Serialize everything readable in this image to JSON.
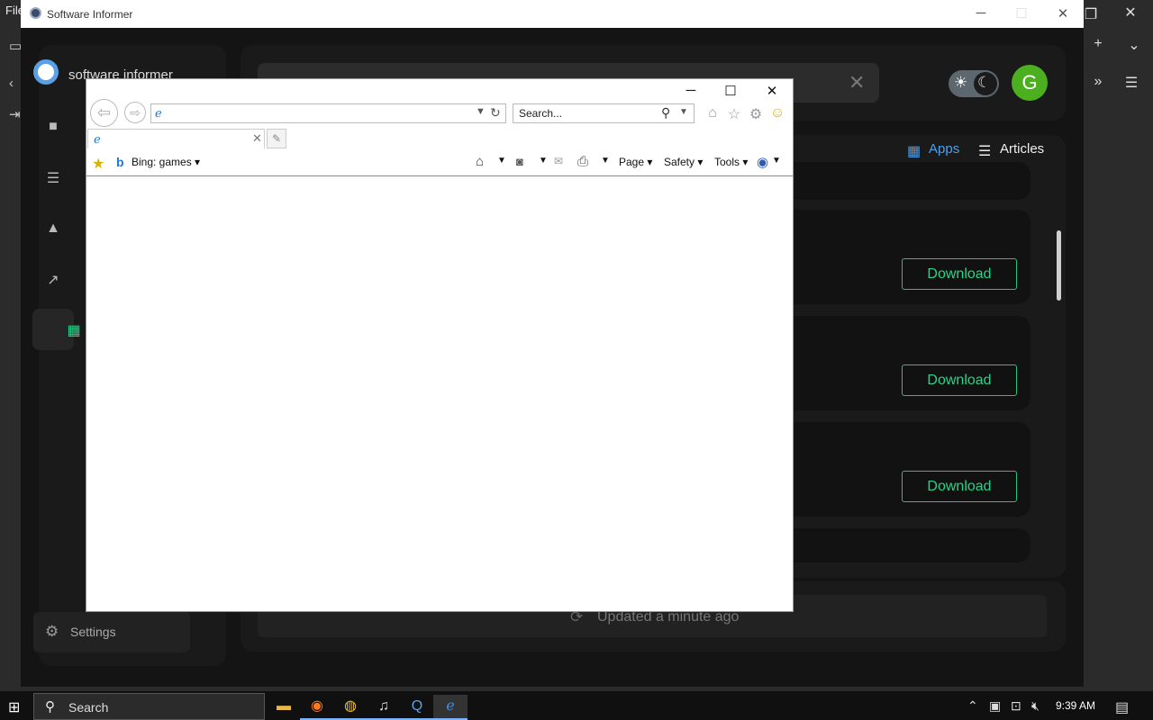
{
  "background_app": {
    "menu_file": "File"
  },
  "software_informer": {
    "title": "Software Informer",
    "logo_text": "software informer",
    "avatar_letter": "G",
    "tabs": [
      {
        "label": "Apps",
        "active": true
      },
      {
        "label": "Articles",
        "active": false
      }
    ],
    "download_buttons": [
      "Download",
      "Download",
      "Download"
    ],
    "settings_label": "Settings",
    "status_text": "Updated a minute ago"
  },
  "ie": {
    "search_placeholder": "Search...",
    "favorites_link": "Bing: games",
    "commands": [
      "Page",
      "Safety",
      "Tools"
    ]
  },
  "taskbar": {
    "search_label": "Search",
    "clock": "9:39 AM"
  }
}
